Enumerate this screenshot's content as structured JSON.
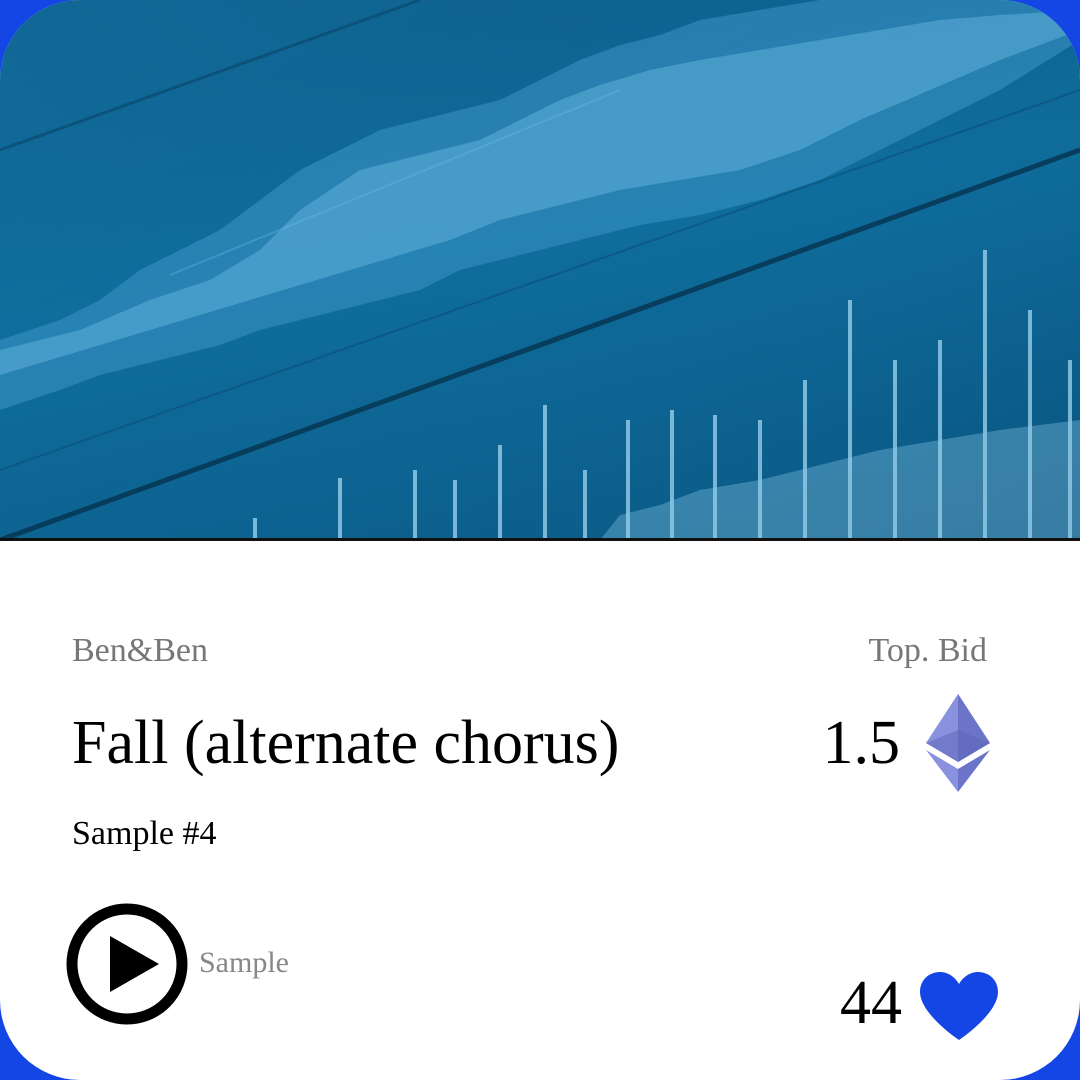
{
  "track": {
    "artist": "Ben&Ben",
    "title": "Fall (alternate chorus)",
    "subtitle": "Sample #4"
  },
  "bid": {
    "label": "Top. Bid",
    "value": "1.5",
    "currency_icon": "ethereum-icon"
  },
  "player": {
    "play_icon": "play-icon",
    "label": "Sample"
  },
  "likes": {
    "count": "44",
    "icon": "heart-icon"
  },
  "colors": {
    "accent": "#1446e6",
    "hero": "#0f6d9c",
    "eth": "#7b84d6"
  }
}
